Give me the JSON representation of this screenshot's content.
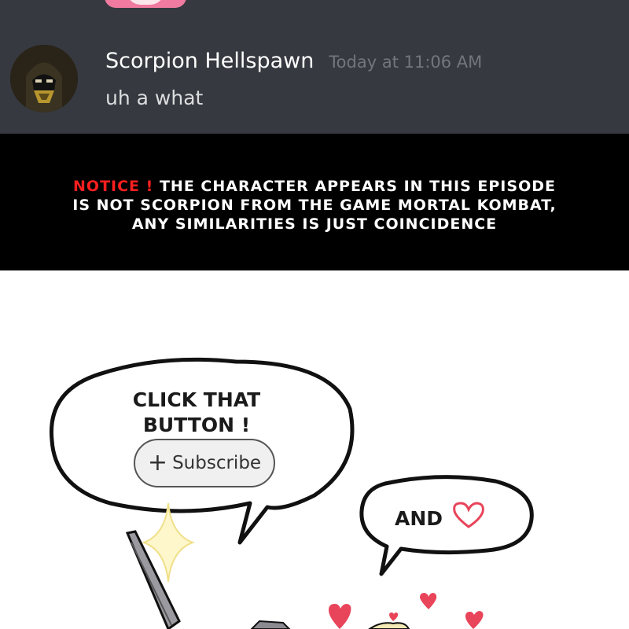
{
  "chat": {
    "username": "Scorpion Hellspawn",
    "timestamp": "Today at 11:06 AM",
    "message": "uh a what"
  },
  "notice": {
    "label": "NOTICE !",
    "line1": "THE CHARACTER APPEARS IN THIS EPISODE",
    "line2": "IS NOT SCORPION FROM THE GAME MORTAL KOMBAT,",
    "line3": "ANY SIMILARITIES IS JUST COINCIDENCE"
  },
  "comic": {
    "bubble1_line1": "CLICK THAT",
    "bubble1_line2": "BUTTON !",
    "subscribe_label": "Subscribe",
    "bubble2_text": "AND"
  },
  "colors": {
    "chat_bg": "#36393f",
    "notice_red": "#ff1f1f",
    "heart": "#e8445a"
  }
}
